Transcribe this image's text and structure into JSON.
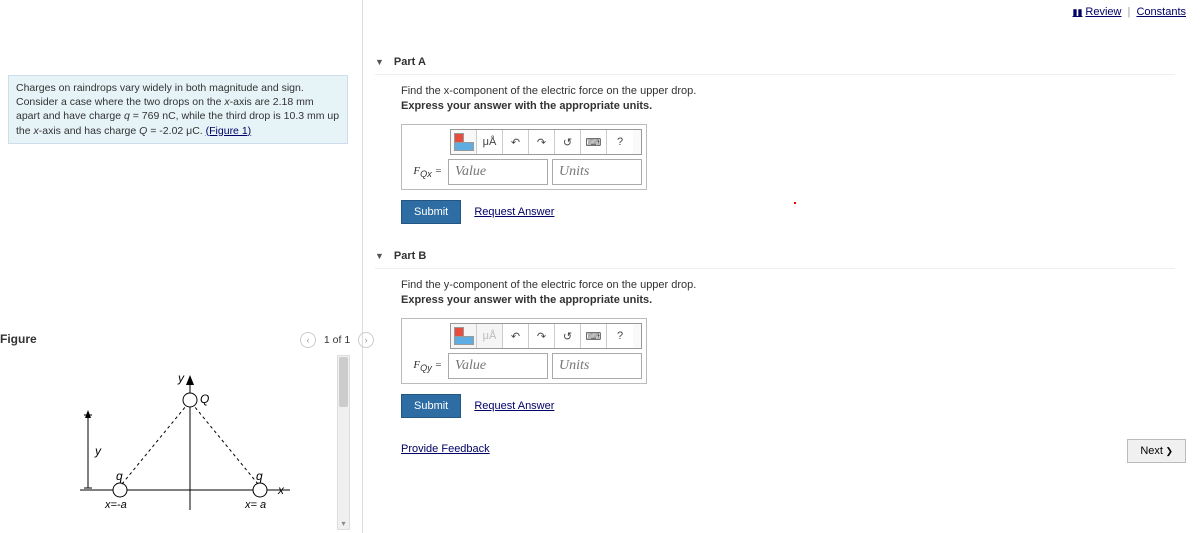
{
  "topLinks": {
    "review": "Review",
    "constants": "Constants"
  },
  "problem": {
    "text1": "Charges on raindrops vary widely in both magnitude and sign. Consider a case where the two drops on the ",
    "xaxis": "x",
    "text2": "-axis are 2.18 mm apart and have charge ",
    "qvar": "q",
    "text3": " = 769 nC, while the third drop is 10.3 mm up the ",
    "text4": "-axis and has charge ",
    "Qvar": "Q",
    "text5": " = -2.02 μC. ",
    "figlink": "(Figure 1)"
  },
  "figure": {
    "label": "Figure",
    "nav": "1 of 1"
  },
  "partA": {
    "title": "Part A",
    "question": "Find the x-component of the electric force on the upper drop.",
    "hint": "Express your answer with the appropriate units.",
    "lhs": "F_Qx ="
  },
  "partB": {
    "title": "Part B",
    "question": "Find the y-component of the electric force on the upper drop.",
    "hint": "Express your answer with the appropriate units.",
    "lhs": "F_Qy ="
  },
  "toolbar": {
    "ua": "μÅ",
    "undo": "↶",
    "redo": "↷",
    "reset": "↺",
    "kbd": "⌨",
    "help": "?"
  },
  "placeholders": {
    "value": "Value",
    "units": "Units"
  },
  "buttons": {
    "submit": "Submit",
    "request": "Request Answer",
    "feedback": "Provide Feedback",
    "next": "Next"
  },
  "svgLabels": {
    "y": "y",
    "Q": "Q",
    "q": "q",
    "xneg": "x=-a",
    "xpos": "x= a",
    "xaxis": "x"
  }
}
